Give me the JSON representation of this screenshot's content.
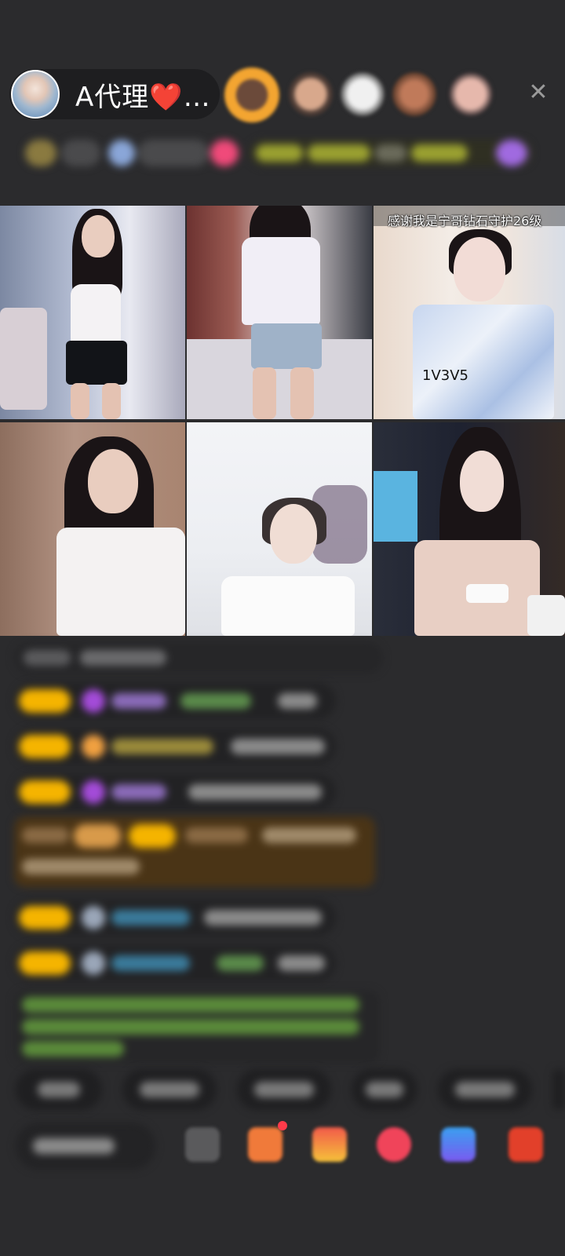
{
  "host": {
    "name": "A代理❤️…",
    "avatar_icon": "host-avatar-icon"
  },
  "top_bar": {
    "close_icon": "close-icon",
    "close_glyph": "✕"
  },
  "tiles": [
    {
      "id": "tile-1"
    },
    {
      "id": "tile-2"
    },
    {
      "id": "tile-3",
      "banner": "感谢我是宁哥钻石守护26级",
      "overlay": "1V3V5"
    },
    {
      "id": "tile-4"
    },
    {
      "id": "tile-5"
    },
    {
      "id": "tile-6"
    }
  ],
  "colors": {
    "background": "#2b2b2d",
    "badge_gold": "#f5b400",
    "gem_purple": "#a34bd8",
    "username_green": "#8bc34a",
    "username_blue": "#4aa3d8",
    "highlight_row": "#4a3416"
  }
}
